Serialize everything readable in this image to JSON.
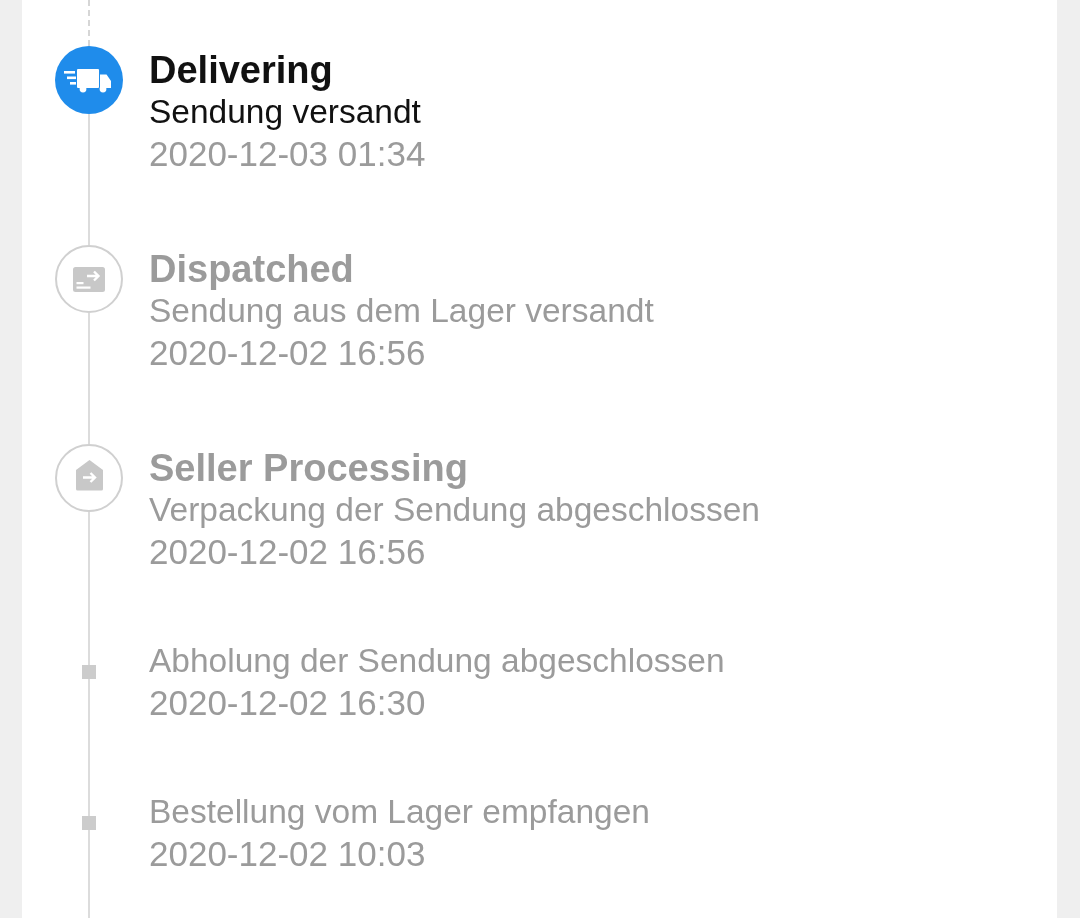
{
  "timeline": [
    {
      "kind": "milestone",
      "active": true,
      "title": "Delivering",
      "description": "Sendung versandt",
      "time": "2020-12-03 01:34"
    },
    {
      "kind": "milestone",
      "active": false,
      "title": "Dispatched",
      "description": "Sendung aus dem Lager versandt",
      "time": "2020-12-02 16:56"
    },
    {
      "kind": "milestone",
      "active": false,
      "title": "Seller Processing",
      "description": "Verpackung der Sendung abgeschlossen",
      "time": "2020-12-02 16:56"
    },
    {
      "kind": "event",
      "active": false,
      "description": "Abholung der Sendung abgeschlossen",
      "time": "2020-12-02 16:30"
    },
    {
      "kind": "event",
      "active": false,
      "description": "Bestellung vom Lager empfangen",
      "time": "2020-12-02 10:03"
    }
  ]
}
